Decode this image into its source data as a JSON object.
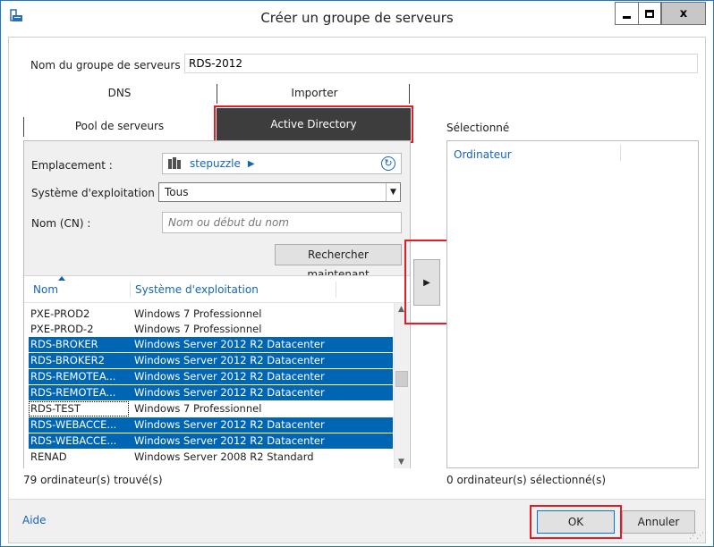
{
  "window": {
    "title": "Créer un groupe de serveurs",
    "controls": {
      "minimize": "minimize-icon",
      "maximize": "maximize-icon",
      "close": "x"
    }
  },
  "form": {
    "group_name_label": "Nom du groupe de serveurs",
    "group_name_value": "RDS-2012"
  },
  "tabs": {
    "dns": "DNS",
    "import": "Importer",
    "pool": "Pool de serveurs",
    "active_directory": "Active Directory"
  },
  "filters": {
    "location_label": "Emplacement :",
    "location_value": "stepuzzle",
    "os_label": "Système d'exploitation :",
    "os_value": "Tous",
    "cn_label": "Nom (CN) :",
    "cn_placeholder": "Nom ou début du nom",
    "search_button": "Rechercher maintenant"
  },
  "list": {
    "columns": [
      "Nom",
      "Système d'exploitation"
    ],
    "rows": [
      {
        "name": "PXE-PROD2",
        "os": "Windows 7 Professionnel",
        "selected": false
      },
      {
        "name": "PXE-PROD-2",
        "os": "Windows 7 Professionnel",
        "selected": false
      },
      {
        "name": "RDS-BROKER",
        "os": "Windows Server 2012 R2 Datacenter",
        "selected": true
      },
      {
        "name": "RDS-BROKER2",
        "os": "Windows Server 2012 R2 Datacenter",
        "selected": true
      },
      {
        "name": "RDS-REMOTEA...",
        "os": "Windows Server 2012 R2 Datacenter",
        "selected": true
      },
      {
        "name": "RDS-REMOTEA...",
        "os": "Windows Server 2012 R2 Datacenter",
        "selected": true
      },
      {
        "name": "RDS-TEST",
        "os": "Windows 7 Professionnel",
        "selected": false,
        "focused": true
      },
      {
        "name": "RDS-WEBACCE...",
        "os": "Windows Server 2012 R2 Datacenter",
        "selected": true
      },
      {
        "name": "RDS-WEBACCE...",
        "os": "Windows Server 2012 R2 Datacenter",
        "selected": true
      },
      {
        "name": "RENAD",
        "os": "Windows Server 2008 R2 Standard",
        "selected": false
      }
    ],
    "found_text": "79 ordinateur(s) trouvé(s)"
  },
  "selected_panel": {
    "title": "Sélectionné",
    "column": "Ordinateur",
    "count_text": "0 ordinateur(s) sélectionné(s)"
  },
  "footer": {
    "help": "Aide",
    "ok": "OK",
    "cancel": "Annuler"
  },
  "colors": {
    "selection": "#0065b2",
    "link": "#1764b5",
    "highlight_box": "#e51c23",
    "active_tab": "#3d3d3d"
  }
}
